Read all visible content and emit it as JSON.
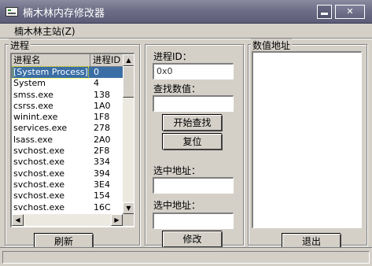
{
  "window": {
    "title": "楠木林内存修改器"
  },
  "menu": {
    "items": [
      {
        "label": "楠木林主站(Z)"
      }
    ]
  },
  "process_panel": {
    "group_label": "进程",
    "columns": [
      "进程名",
      "进程ID"
    ],
    "rows": [
      {
        "name": "[System Process]",
        "id": "0"
      },
      {
        "name": "System",
        "id": "4"
      },
      {
        "name": "smss.exe",
        "id": "138"
      },
      {
        "name": "csrss.exe",
        "id": "1A0"
      },
      {
        "name": "winint.exe",
        "id": "1F8"
      },
      {
        "name": "services.exe",
        "id": "278"
      },
      {
        "name": "lsass.exe",
        "id": "2A0"
      },
      {
        "name": "svchost.exe",
        "id": "2F8"
      },
      {
        "name": "svchost.exe",
        "id": "334"
      },
      {
        "name": "svchost.exe",
        "id": "394"
      },
      {
        "name": "svchost.exe",
        "id": "3E4"
      },
      {
        "name": "svchost.exe",
        "id": "154"
      },
      {
        "name": "svchost.exe",
        "id": "16C"
      }
    ],
    "refresh_label": "刷新"
  },
  "search_panel": {
    "pid_label": "进程ID：",
    "pid_value": "0x0",
    "search_value_label": "查找数值：",
    "search_value": "",
    "start_search_label": "开始查找",
    "reset_label": "复位",
    "selected_addr_label_1": "选中地址：",
    "selected_addr_value_1": "",
    "selected_addr_label_2": "选中地址：",
    "selected_addr_value_2": "",
    "modify_label": "修改"
  },
  "address_panel": {
    "group_label": "数值地址",
    "exit_label": "退出"
  }
}
